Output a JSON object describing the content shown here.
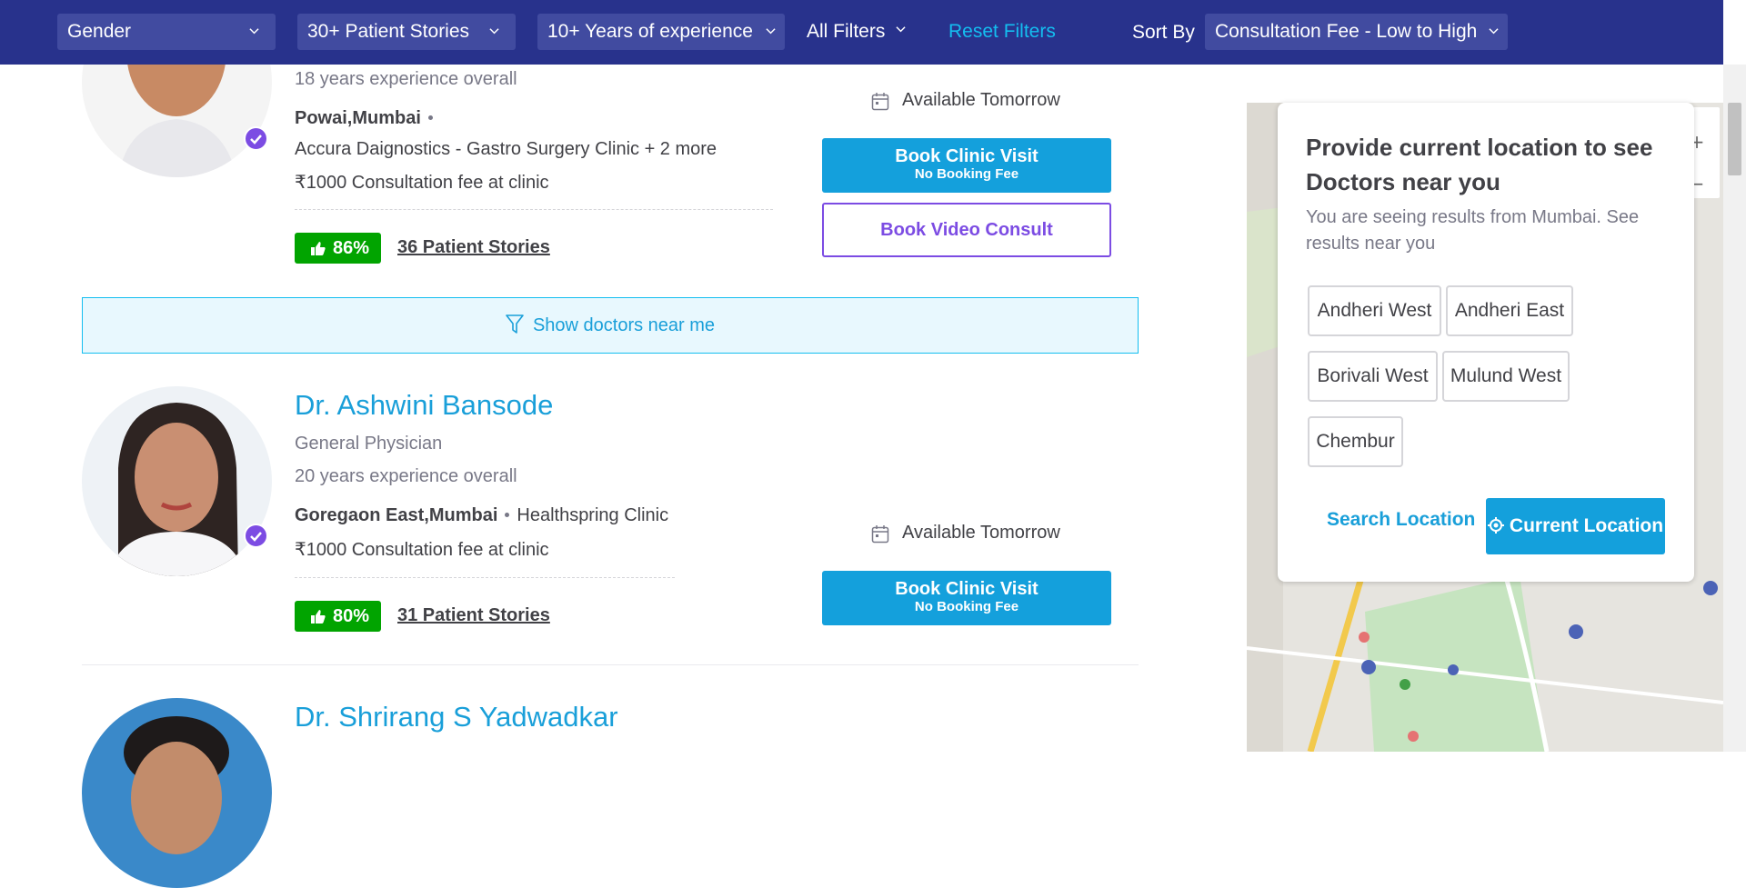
{
  "filters": {
    "gender": "Gender",
    "patient_stories": "30+ Patient Stories",
    "experience": "10+ Years of experience",
    "all_filters": "All Filters",
    "reset": "Reset Filters",
    "sort_label": "Sort By",
    "sort_value": "Consultation Fee - Low to High"
  },
  "doctors": [
    {
      "experience": "18 years experience overall",
      "location": "Powai,Mumbai",
      "clinic": "Accura Daignostics - Gastro Surgery Clinic + 2 more",
      "fee": "₹1000 Consultation fee at clinic",
      "rating": "86%",
      "stories": "36 Patient Stories",
      "availability": "Available Tomorrow",
      "book_clinic": "Book Clinic Visit",
      "book_clinic_sub": "No Booking Fee",
      "book_video": "Book Video Consult"
    },
    {
      "name": "Dr. Ashwini Bansode",
      "specialty": "General Physician",
      "experience": "20 years experience overall",
      "location": "Goregaon East,Mumbai",
      "clinic": "Healthspring Clinic",
      "fee": "₹1000 Consultation fee at clinic",
      "rating": "80%",
      "stories": "31 Patient Stories",
      "availability": "Available Tomorrow",
      "book_clinic": "Book Clinic Visit",
      "book_clinic_sub": "No Booking Fee"
    },
    {
      "name": "Dr. Shrirang S Yadwadkar"
    }
  ],
  "show_near": "Show doctors near me",
  "location_popup": {
    "title": "Provide current location to see Doctors near you",
    "subtitle": "You are seeing results from Mumbai. See results near you",
    "chips": [
      "Andheri West",
      "Andheri East",
      "Borivali West",
      "Mulund West",
      "Chembur"
    ],
    "search": "Search Location",
    "current": "Current Location"
  },
  "colors": {
    "filter_bar": "#28328c",
    "filter_select": "#414ba0",
    "link_blue": "#199fd9",
    "primary_button": "#14a0dc",
    "video_button": "#7c4ce3",
    "rating_green": "#01a400"
  }
}
